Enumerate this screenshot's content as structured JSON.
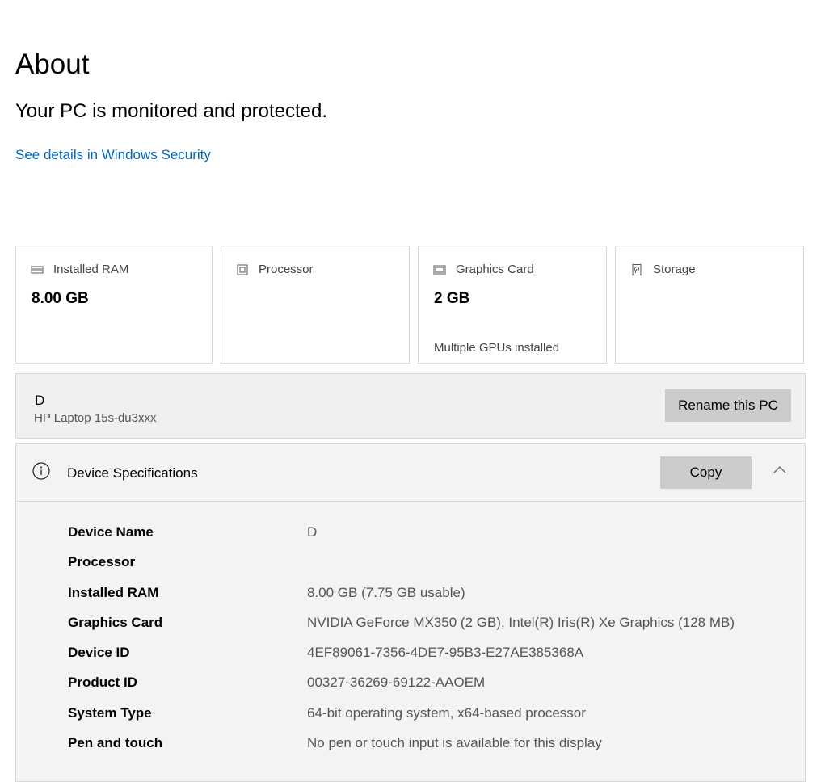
{
  "page": {
    "title": "About",
    "protection_text": "Your PC is monitored and protected.",
    "security_link": "See details in Windows Security"
  },
  "cards": [
    {
      "icon": "ram-icon",
      "label": "Installed RAM",
      "value": "8.00 GB",
      "sub": ""
    },
    {
      "icon": "processor-icon",
      "label": "Processor",
      "value": "",
      "sub": ""
    },
    {
      "icon": "graphics-card-icon",
      "label": "Graphics Card",
      "value": "2 GB",
      "sub": "Multiple GPUs installed"
    },
    {
      "icon": "storage-icon",
      "label": "Storage",
      "value": "",
      "sub": ""
    }
  ],
  "pc": {
    "name": "D",
    "model": "HP Laptop 15s-du3xxx",
    "rename_label": "Rename this PC"
  },
  "specs": {
    "title": "Device Specifications",
    "copy_label": "Copy",
    "rows": [
      {
        "key": "Device Name",
        "value": "D"
      },
      {
        "key": "Processor",
        "value": ""
      },
      {
        "key": "Installed RAM",
        "value": "8.00 GB (7.75 GB usable)"
      },
      {
        "key": "Graphics Card",
        "value": "NVIDIA GeForce MX350 (2 GB), Intel(R) Iris(R) Xe Graphics (128 MB)"
      },
      {
        "key": "Device ID",
        "value": "4EF89061-7356-4DE7-95B3-E27AE385368A"
      },
      {
        "key": "Product ID",
        "value": "00327-36269-69122-AAOEM"
      },
      {
        "key": "System Type",
        "value": "64-bit operating system, x64-based processor"
      },
      {
        "key": "Pen and touch",
        "value": "No pen or touch input is available for this display"
      }
    ]
  },
  "colors": {
    "link": "#0067c0",
    "button_bg": "#cccccc",
    "panel_bg": "#f3f3f3"
  }
}
